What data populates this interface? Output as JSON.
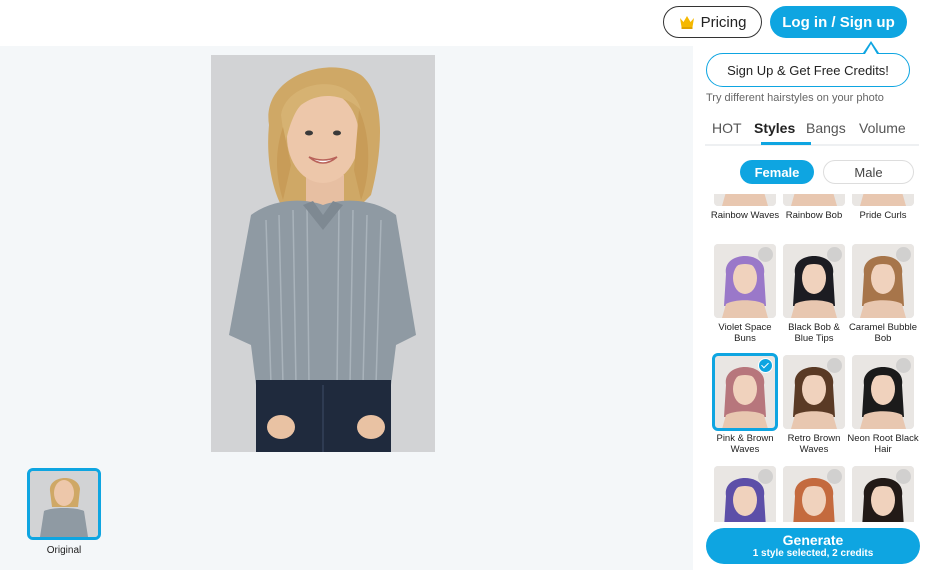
{
  "header": {
    "pricing_label": "Pricing",
    "login_label": "Log in / Sign up",
    "tooltip_label": "Sign Up & Get Free Credits!"
  },
  "canvas": {
    "thumbnail_label": "Original"
  },
  "panel": {
    "subtitle": "Try different hairstyles on your photo",
    "tabs": [
      {
        "label": "HOT"
      },
      {
        "label": "Styles"
      },
      {
        "label": "Bangs"
      },
      {
        "label": "Volume"
      }
    ],
    "active_tab": "Styles",
    "gender": {
      "female": "Female",
      "male": "Male",
      "selected": "Female"
    },
    "styles": [
      {
        "label": "Rainbow Waves",
        "hair": "#7a5bd0",
        "selected": false
      },
      {
        "label": "Rainbow Bob",
        "hair": "#c98a6a",
        "selected": false
      },
      {
        "label": "Pride Curls",
        "hair": "#b0573e",
        "selected": false
      },
      {
        "label": "Violet Space Buns",
        "hair": "#9a78c9",
        "selected": false
      },
      {
        "label": "Black Bob & Blue Tips",
        "hair": "#1c1c22",
        "selected": false
      },
      {
        "label": "Caramel Bubble Bob",
        "hair": "#a7754a",
        "selected": false
      },
      {
        "label": "Pink & Brown Waves",
        "hair": "#b7767c",
        "selected": true
      },
      {
        "label": "Retro Brown Waves",
        "hair": "#5a3a25",
        "selected": false
      },
      {
        "label": "Neon Root Black Hair",
        "hair": "#1b1b1b",
        "selected": false
      },
      {
        "label": "",
        "hair": "#5d4fa8",
        "selected": false
      },
      {
        "label": "",
        "hair": "#c46a3e",
        "selected": false
      },
      {
        "label": "",
        "hair": "#221a17",
        "selected": false
      }
    ],
    "generate": {
      "title": "Generate",
      "subtitle": "1 style selected, 2 credits"
    }
  },
  "colors": {
    "accent": "#0ea5e1",
    "canvas_bg": "#f4f7f9"
  }
}
